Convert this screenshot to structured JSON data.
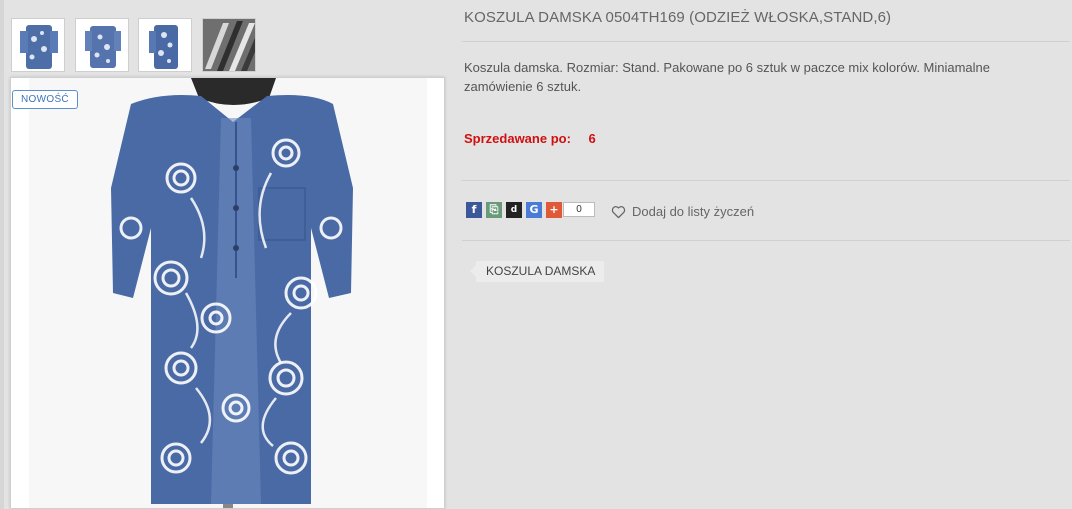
{
  "product": {
    "title": "KOSZULA DAMSKA 0504TH169 (ODZIEŻ WŁOSKA,STAND,6)",
    "description": "Koszula damska. Rozmiar: Stand. Pakowane po 6 sztuk w paczce mix kolorów. Miniamalne zamówienie 6 sztuk.",
    "sold_by_label": "Sprzedawane po:",
    "sold_by_value": "6",
    "badge": "NOWOŚĆ"
  },
  "gallery": {
    "thumbnails": [
      "thumb-front",
      "thumb-back",
      "thumb-side",
      "thumb-fabric"
    ],
    "main_image_icon": "shirt-image"
  },
  "share": {
    "buttons": [
      {
        "icon": "facebook-icon",
        "glyph": "f",
        "color": "#3b5998"
      },
      {
        "icon": "share-icon",
        "glyph": "⎘",
        "color": "#6a9a7a"
      },
      {
        "icon": "digg-icon",
        "glyph": "d",
        "color": "#222222"
      },
      {
        "icon": "google-icon",
        "glyph": "G",
        "color": "#4a7bd6"
      },
      {
        "icon": "plus-icon",
        "glyph": "+",
        "color": "#e05a3a"
      }
    ],
    "count": "0"
  },
  "wishlist_label": "Dodaj do listy życzeń",
  "tag_label": "KOSZULA DAMSKA",
  "colors": {
    "price_red": "#d01010",
    "denim": "#4a6aa6",
    "badge_blue": "#3d73b8"
  }
}
